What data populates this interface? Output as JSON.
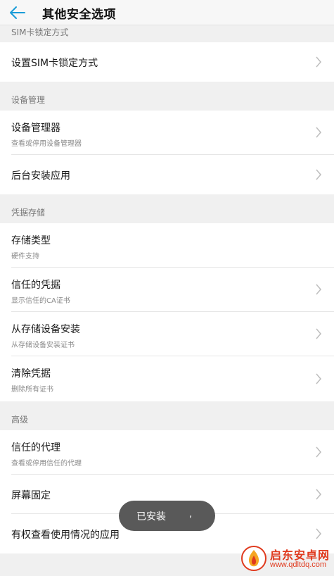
{
  "header": {
    "title": "其他安全选项"
  },
  "sections": {
    "sim": {
      "header": "SIM卡锁定方式",
      "items": [
        {
          "title": "设置SIM卡锁定方式"
        }
      ]
    },
    "device": {
      "header": "设备管理",
      "items": [
        {
          "title": "设备管理器",
          "subtitle": "查看或停用设备管理器"
        },
        {
          "title": "后台安装应用"
        }
      ]
    },
    "credentials": {
      "header": "凭据存储",
      "items": [
        {
          "title": "存储类型",
          "subtitle": "硬件支持"
        },
        {
          "title": "信任的凭据",
          "subtitle": "显示信任的CA证书"
        },
        {
          "title": "从存储设备安装",
          "subtitle": "从存储设备安装证书"
        },
        {
          "title": "清除凭据",
          "subtitle": "删除所有证书"
        }
      ]
    },
    "advanced": {
      "header": "高级",
      "items": [
        {
          "title": "信任的代理",
          "subtitle": "查看或停用信任的代理"
        },
        {
          "title": "屏幕固定"
        },
        {
          "title": "有权查看使用情况的应用"
        }
      ]
    }
  },
  "toast": {
    "text": "已安装",
    "mark": ","
  },
  "watermark": {
    "name": "启东安卓网",
    "url": "www.qdltdq.com"
  },
  "colors": {
    "accent": "#1a9cd8",
    "watermark": "#e03a1e"
  },
  "icons": {
    "back": "arrow-left-icon",
    "chevron": "chevron-right-icon"
  }
}
